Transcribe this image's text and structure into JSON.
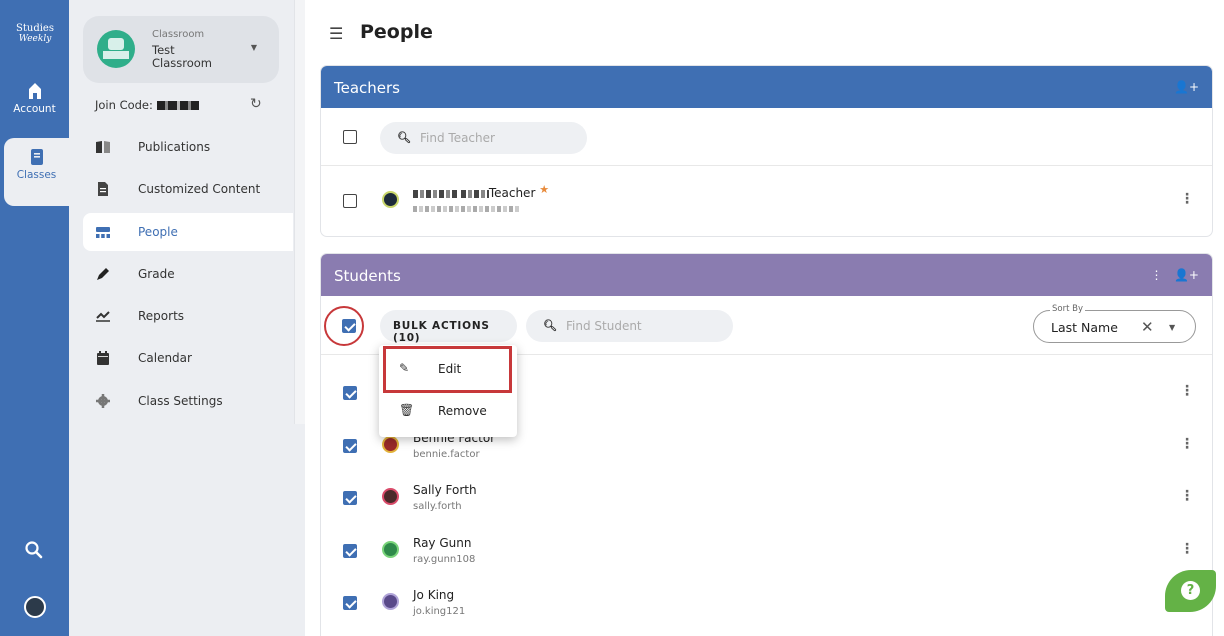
{
  "rail": {
    "logo_line1": "Studies",
    "logo_line2": "Weekly",
    "account_label": "Account",
    "classes_label": "Classes"
  },
  "sidebar": {
    "class_label": "Classroom",
    "class_name": "Test Classroom",
    "join_code_label": "Join Code:",
    "items": [
      {
        "label": "Publications",
        "icon": "book-icon"
      },
      {
        "label": "Customized Content",
        "icon": "document-icon"
      },
      {
        "label": "People",
        "icon": "people-icon",
        "active": true
      },
      {
        "label": "Grade",
        "icon": "pen-icon"
      },
      {
        "label": "Reports",
        "icon": "chart-icon"
      },
      {
        "label": "Calendar",
        "icon": "calendar-icon"
      },
      {
        "label": "Class Settings",
        "icon": "gear-icon"
      }
    ]
  },
  "main": {
    "page_title": "People",
    "teachers": {
      "title": "Teachers",
      "search_placeholder": "Find Teacher",
      "teacher_suffix": "Teacher",
      "star": "★"
    },
    "students": {
      "title": "Students",
      "bulk_actions": "BULK ACTIONS (10)",
      "search_placeholder": "Find Student",
      "sort_label": "Sort By",
      "sort_value": "Last Name",
      "bulk_menu": [
        "Edit",
        "Remove"
      ],
      "rows": [
        {
          "name": "",
          "username": ""
        },
        {
          "name": "Bennie Factor",
          "username": "bennie.factor"
        },
        {
          "name": "Sally Forth",
          "username": "sally.forth"
        },
        {
          "name": "Ray Gunn",
          "username": "ray.gunn108"
        },
        {
          "name": "Jo King",
          "username": "jo.king121"
        }
      ]
    }
  },
  "colors": {
    "rail_blue": "#3f6fb3",
    "teachers_header": "#3f6fb3",
    "students_header": "#8a7cb0",
    "highlight_red": "#c7383a",
    "help_green": "#64b246"
  }
}
